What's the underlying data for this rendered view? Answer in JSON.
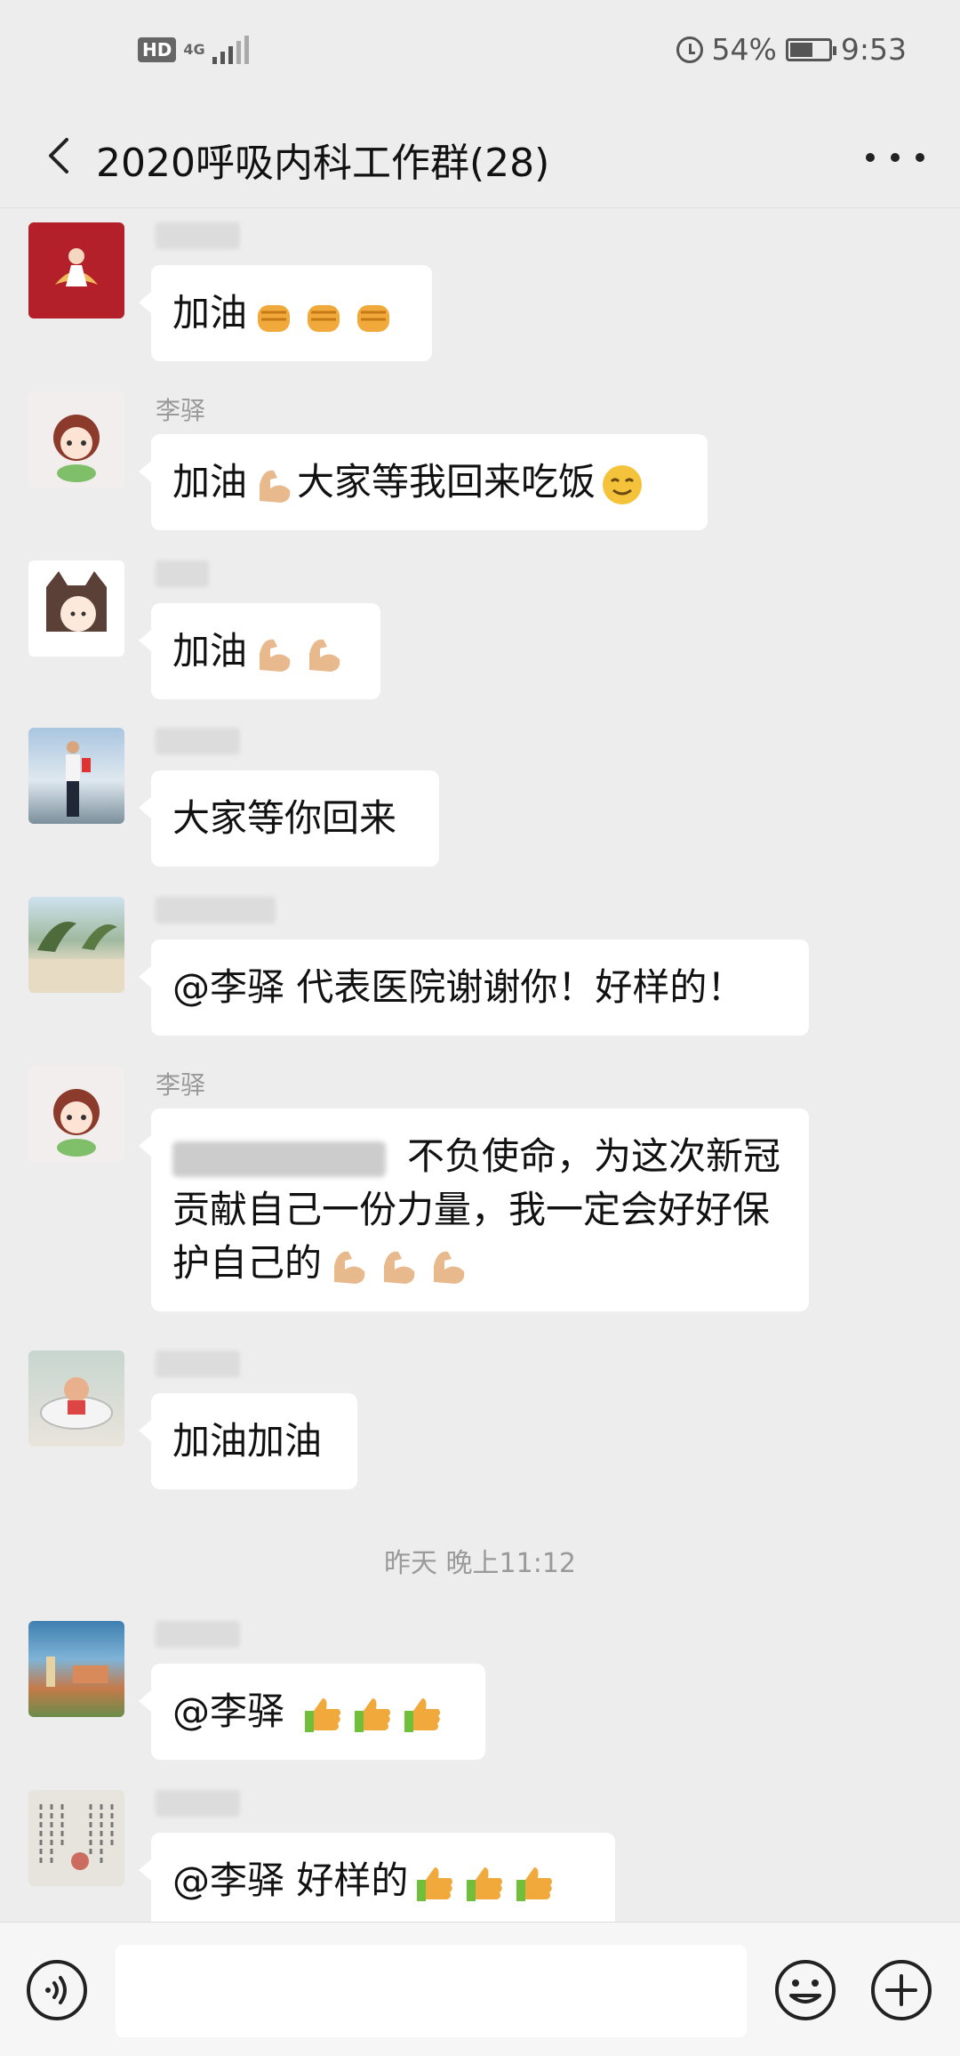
{
  "status_bar": {
    "hd": "HD",
    "network": "4G",
    "battery": "54%",
    "battery_level": 0.54,
    "time": "9:53"
  },
  "header": {
    "title": "2020呼吸内科工作群(28)"
  },
  "messages": [
    {
      "sender": "",
      "sender_blurred": true,
      "avatar": "avatar-red-figure",
      "text": "加油",
      "emoji": [
        "raised-fist",
        "raised-fist",
        "raised-fist"
      ]
    },
    {
      "sender": "李驿",
      "avatar": "avatar-girl-cartoon",
      "text": "加油",
      "emoji_mid": "flexed-biceps",
      "text_after": "大家等我回来吃饭",
      "emoji": [
        "relieved-face"
      ]
    },
    {
      "sender": "",
      "sender_blurred": true,
      "avatar": "avatar-girl-cat-hood",
      "text": "加油",
      "emoji": [
        "flexed-biceps",
        "flexed-biceps"
      ]
    },
    {
      "sender": "",
      "sender_blurred": true,
      "avatar": "avatar-man-seaside",
      "text": "大家等你回来"
    },
    {
      "sender": "",
      "sender_blurred": true,
      "avatar": "avatar-beach-palms",
      "text": "@李驿  代表医院谢谢你！好样的！"
    },
    {
      "sender": "李驿",
      "avatar": "avatar-girl-cartoon",
      "text": "不负使命，为这次新冠贡献自己一份力量，我一定会好好保护自己的",
      "emoji": [
        "flexed-biceps",
        "flexed-biceps",
        "flexed-biceps"
      ]
    },
    {
      "sender": "",
      "sender_blurred": true,
      "avatar": "avatar-baby-tub",
      "text": "加油加油"
    },
    {
      "sender": "",
      "sender_blurred": true,
      "avatar": "avatar-coastal-town",
      "text": "@李驿 ",
      "emoji": [
        "thumbs-up",
        "thumbs-up",
        "thumbs-up"
      ]
    },
    {
      "sender": "",
      "sender_blurred": true,
      "avatar": "avatar-calligraphy",
      "text": "@李驿  好样的",
      "emoji": [
        "thumbs-up",
        "thumbs-up",
        "thumbs-up"
      ]
    }
  ],
  "timestamp": "昨天 晚上11:12",
  "input_bar": {
    "voice_icon": "voice-icon",
    "emoji_icon": "emoji-icon",
    "plus_icon": "plus-icon",
    "placeholder": ""
  }
}
